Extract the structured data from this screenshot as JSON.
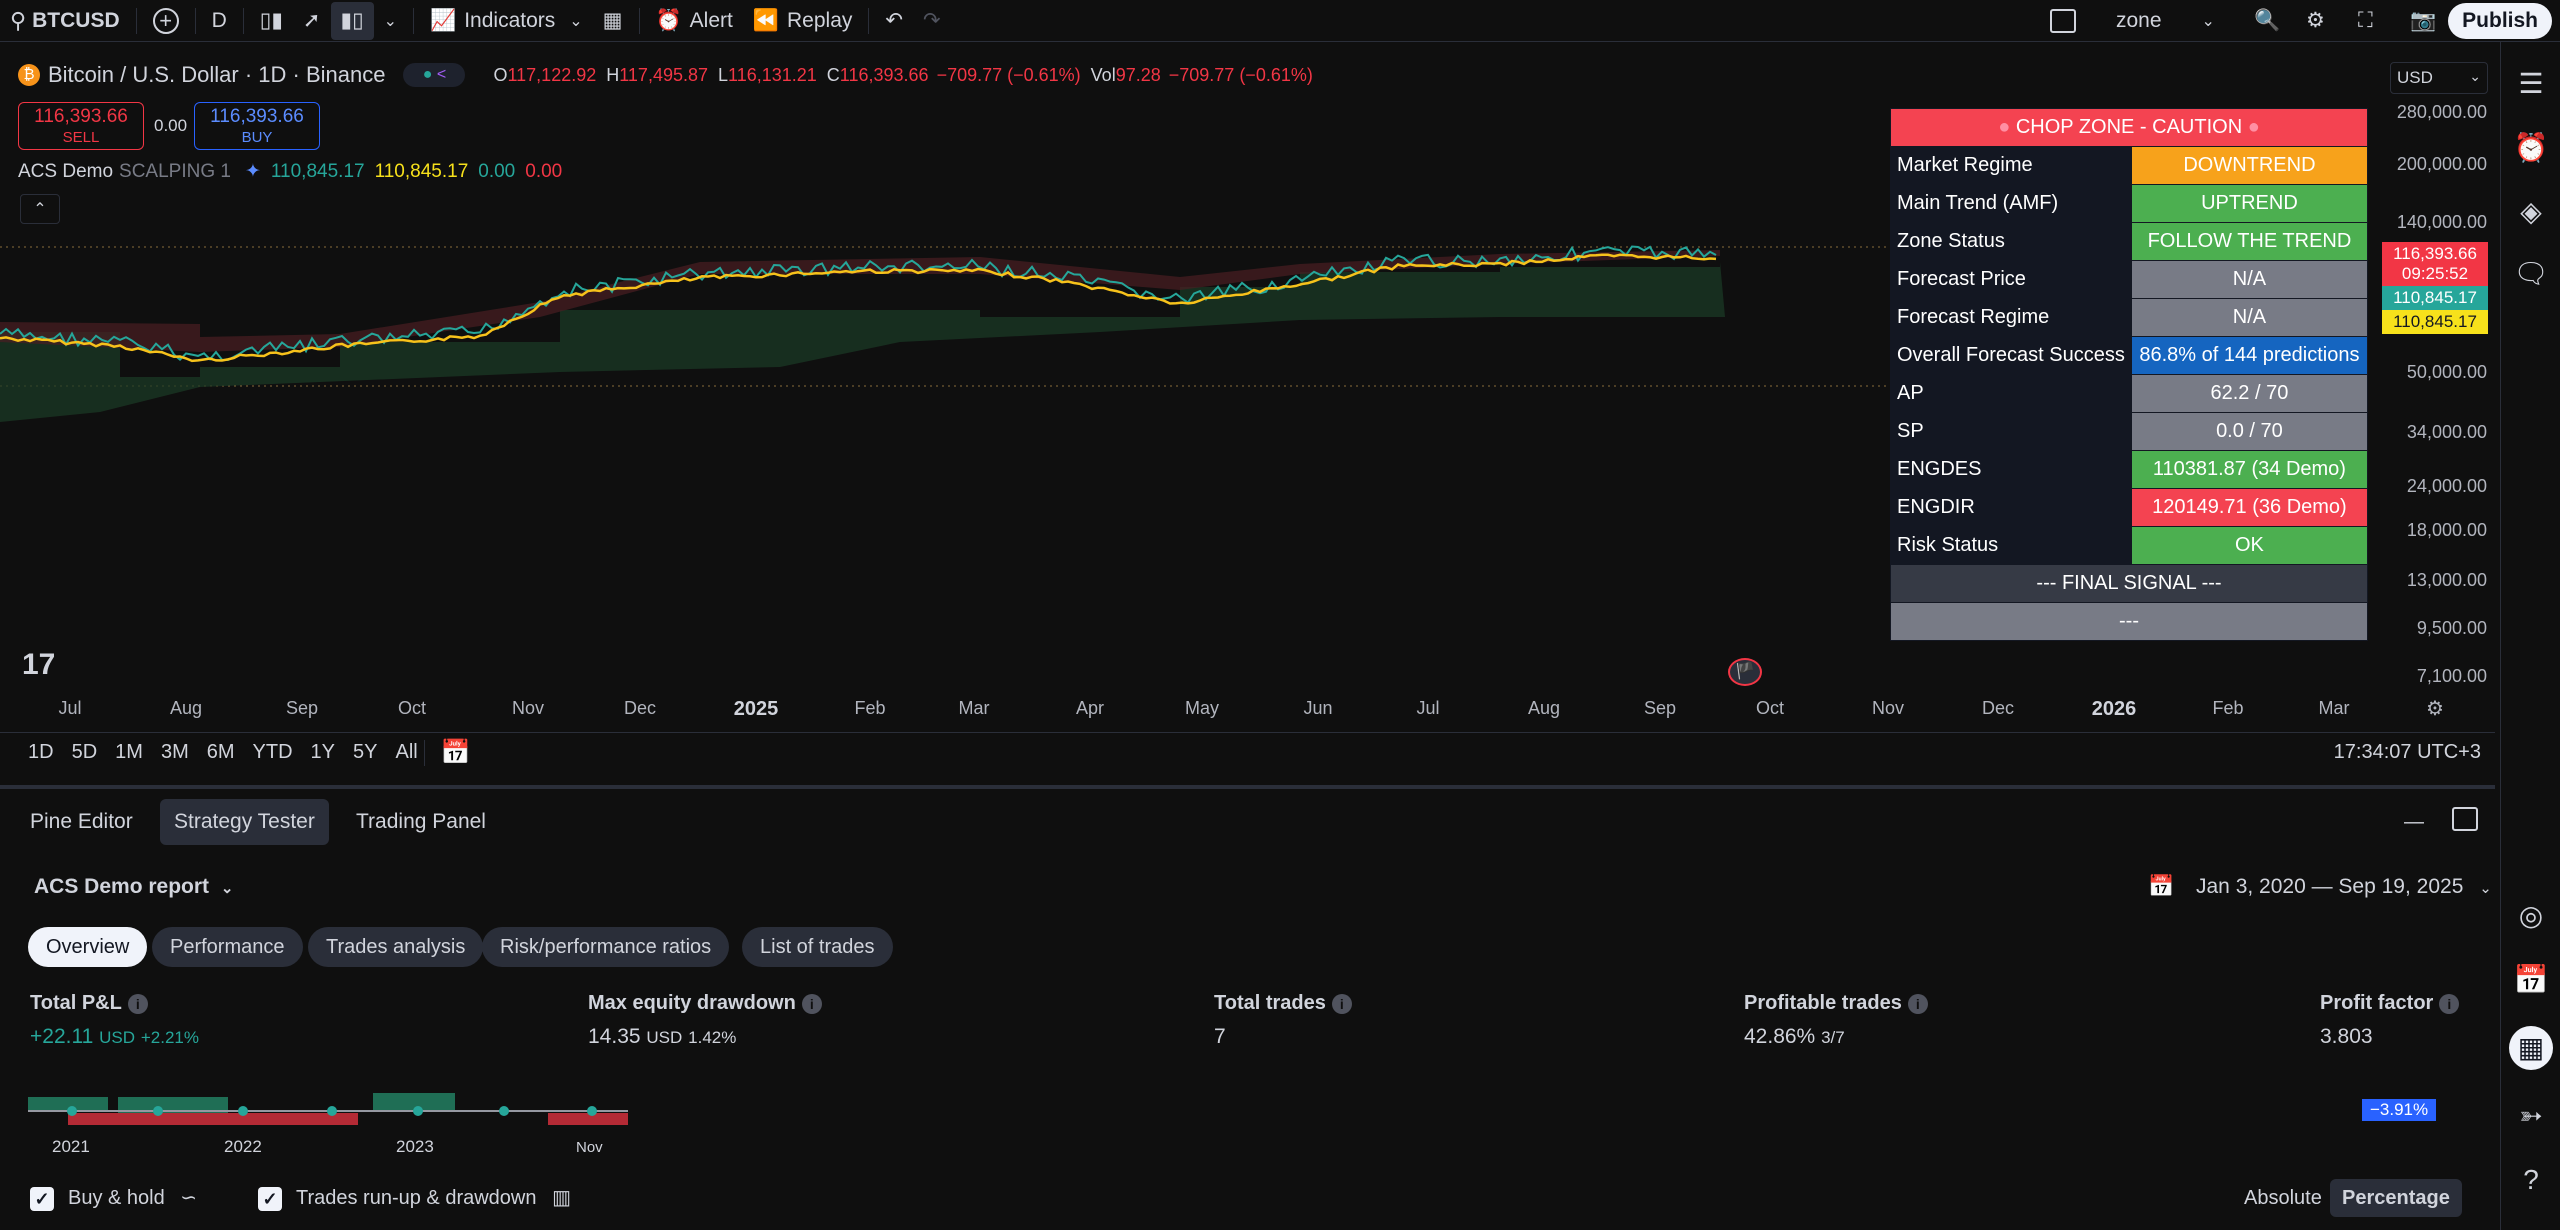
{
  "toolbar": {
    "symbol": "BTCUSD",
    "interval": "D",
    "indicators": "Indicators",
    "alert": "Alert",
    "replay": "Replay",
    "layout_name": "zone",
    "publish": "Publish"
  },
  "legend": {
    "title": "Bitcoin / U.S. Dollar · 1D · Binance",
    "open_k": "O",
    "open": "117,122.92",
    "high_k": "H",
    "high": "117,495.87",
    "low_k": "L",
    "low": "116,131.21",
    "close_k": "C",
    "close": "116,393.66",
    "change": "−709.77 (−0.61%)",
    "vol_k": "Vol",
    "vol": "97.28",
    "vol_change": "−709.77 (−0.61%)",
    "sell_price": "116,393.66",
    "sell_label": "SELL",
    "spread": "0.00",
    "buy_price": "116,393.66",
    "buy_label": "BUY",
    "indicator_name": "ACS Demo",
    "indicator_params": "SCALPING 1",
    "ind_v1": "110,845.17",
    "ind_v2": "110,845.17",
    "ind_v3": "0.00",
    "ind_v4": "0.00"
  },
  "regime_table": {
    "header": "CHOP ZONE - CAUTION",
    "rows": [
      {
        "label": "Market Regime",
        "value": "DOWNTREND",
        "color": "#f7a21b"
      },
      {
        "label": "Main Trend (AMF)",
        "value": "UPTREND",
        "color": "#4caf50"
      },
      {
        "label": "Zone Status",
        "value": "FOLLOW THE TREND",
        "color": "#4caf50"
      },
      {
        "label": "Forecast Price",
        "value": "N/A",
        "color": "#787b86"
      },
      {
        "label": "Forecast Regime",
        "value": "N/A",
        "color": "#787b86"
      },
      {
        "label": "Overall Forecast Success",
        "value": "86.8% of 144 predictions",
        "color": "#1565c0"
      },
      {
        "label": "AP",
        "value": "62.2 / 70",
        "color": "#787b86"
      },
      {
        "label": "SP",
        "value": "0.0 / 70",
        "color": "#787b86"
      },
      {
        "label": "ENGDES",
        "value": "110381.87 (34 Demo)",
        "color": "#4caf50"
      },
      {
        "label": "ENGDIR",
        "value": "120149.71 (36 Demo)",
        "color": "#f44351"
      },
      {
        "label": "Risk Status",
        "value": "OK",
        "color": "#4caf50"
      }
    ],
    "final_signal": "--- FINAL SIGNAL ---",
    "final_value": "---"
  },
  "price_axis": {
    "currency": "USD",
    "ticks": [
      "280,000.00",
      "200,000.00",
      "140,000.00",
      "50,000.00",
      "34,000.00",
      "24,000.00",
      "18,000.00",
      "13,000.00",
      "9,500.00",
      "7,100.00"
    ],
    "tag_last": "116,393.66",
    "tag_countdown": "09:25:52",
    "tag_ind1": "110,845.17",
    "tag_ind2": "110,845.17"
  },
  "time_axis": {
    "labels": [
      "Jul",
      "Aug",
      "Sep",
      "Oct",
      "Nov",
      "Dec",
      "2025",
      "Feb",
      "Mar",
      "Apr",
      "May",
      "Jun",
      "Jul",
      "Aug",
      "Sep",
      "Oct",
      "Nov",
      "Dec",
      "2026",
      "Feb",
      "Mar"
    ]
  },
  "ranges": [
    "1D",
    "5D",
    "1M",
    "3M",
    "6M",
    "YTD",
    "1Y",
    "5Y",
    "All"
  ],
  "clock": "17:34:07 UTC+3",
  "bottom": {
    "tabs": [
      "Pine Editor",
      "Strategy Tester",
      "Trading Panel"
    ],
    "report": "ACS Demo report",
    "date_range": "Jan 3, 2020 — Sep 19, 2025",
    "pills": [
      "Overview",
      "Performance",
      "Trades analysis",
      "Risk/performance ratios",
      "List of trades"
    ],
    "stats": {
      "pnl_h": "Total P&L",
      "pnl_v": "+22.11",
      "pnl_unit": "USD",
      "pnl_pct": "+2.21%",
      "dd_h": "Max equity drawdown",
      "dd_v": "14.35",
      "dd_unit": "USD",
      "dd_pct": "1.42%",
      "trades_h": "Total trades",
      "trades_v": "7",
      "prof_h": "Profitable trades",
      "prof_v": "42.86%",
      "prof_sub": "3/7",
      "pf_h": "Profit factor",
      "pf_v": "3.803"
    },
    "mini_years": [
      "2021",
      "2022",
      "2023",
      "Nov"
    ],
    "neg_badge": "−3.91%",
    "buy_hold": "Buy & hold",
    "runup": "Trades run-up & drawdown",
    "absolute": "Absolute",
    "percentage": "Percentage"
  }
}
